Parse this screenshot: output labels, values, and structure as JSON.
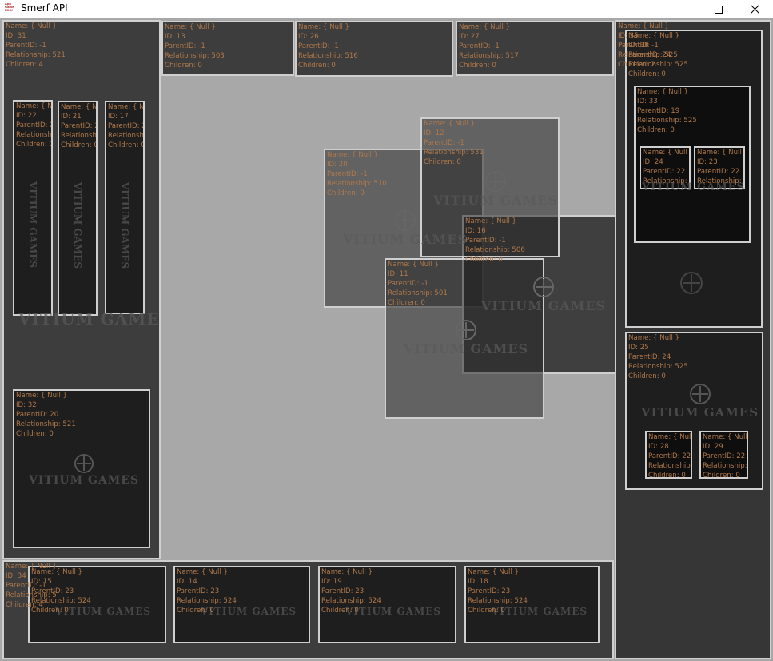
{
  "window": {
    "title": "Smerf API",
    "icon_lines": [
      "App",
      "Game",
      "Kit X"
    ],
    "minimize_icon": "minimize-icon",
    "maximize_icon": "maximize-icon",
    "close_icon": "close-icon"
  },
  "watermark": "VITIUM GAMES",
  "colors": {
    "background": "#a8a8a8",
    "label_text": "#b0784a",
    "border": "#cfcfcf"
  },
  "nodes": {
    "n31": {
      "name": "Name: { Null }",
      "id": "ID: 31",
      "parent": "ParentID: -1",
      "relationship": "Relationship: 521",
      "children": "Children: 4"
    },
    "n22": {
      "name": "Name: { Null }",
      "id": "ID: 22",
      "parent": "ParentID: 21",
      "relationship": "Relationship: 5",
      "children": "Children: 0"
    },
    "n21": {
      "name": "Name: { Null }",
      "id": "ID: 21",
      "parent": "ParentID: 2",
      "relationship": "Relationship: 5",
      "children": "Children: 0"
    },
    "n17": {
      "name": "Name: { Null }",
      "id": "ID: 17",
      "parent": "ParentID: 2",
      "relationship": "Relationship: 5",
      "children": "Children: 0"
    },
    "n32": {
      "name": "Name: { Null }",
      "id": "ID: 32",
      "parent": "ParentID: 20",
      "relationship": "Relationship: 521",
      "children": "Children: 0"
    },
    "n13": {
      "name": "Name: { Null }",
      "id": "ID: 13",
      "parent": "ParentID: -1",
      "relationship": "Relationship: 503",
      "children": "Children: 0"
    },
    "n26": {
      "name": "Name: { Null }",
      "id": "ID: 26",
      "parent": "ParentID: -1",
      "relationship": "Relationship: 516",
      "children": "Children: 0"
    },
    "n27": {
      "name": "Name: { Null }",
      "id": "ID: 27",
      "parent": "ParentID: -1",
      "relationship": "Relationship: 517",
      "children": "Children: 0"
    },
    "n20": {
      "name": "Name: { Null }",
      "id": "ID: 20",
      "parent": "ParentID: -1",
      "relationship": "Relationship: 510",
      "children": "Children: 0"
    },
    "n12": {
      "name": "Name: { Null }",
      "id": "ID: 12",
      "parent": "ParentID: -1",
      "relationship": "Relationship: 531",
      "children": "Children: 0"
    },
    "n16": {
      "name": "Name: { Null }",
      "id": "ID: 16",
      "parent": "ParentID: -1",
      "relationship": "Relationship: 506",
      "children": "Children: 0"
    },
    "n11": {
      "name": "Name: { Null }",
      "id": "ID: 11",
      "parent": "ParentID: -1",
      "relationship": "Relationship: 501",
      "children": "Children: 0"
    },
    "n35": {
      "name": "Name: { Null }",
      "id": "ID: 35",
      "parent": "ParentID: -1",
      "relationship": "Relationship: 525",
      "children": "Children: 2"
    },
    "n30": {
      "name": "Name: { Null }",
      "id": "ID: 30",
      "parent": "ParentID: 24",
      "relationship": "Relationship: 525",
      "children": "Children: 0"
    },
    "n33": {
      "name": "Name: { Null }",
      "id": "ID: 33",
      "parent": "ParentID: 19",
      "relationship": "Relationship: 525",
      "children": "Children: 0"
    },
    "n24": {
      "name": "Name: { Null }",
      "id": "ID: 24",
      "parent": "ParentID: 22",
      "relationship": "Relationship: 5",
      "children": "Children: 0"
    },
    "n23": {
      "name": "Name: { Null }",
      "id": "ID: 23",
      "parent": "ParentID: 22",
      "relationship": "Relationship: 5",
      "children": "Children: 0"
    },
    "n25": {
      "name": "Name: { Null }",
      "id": "ID: 25",
      "parent": "ParentID: 24",
      "relationship": "Relationship: 525",
      "children": "Children: 0"
    },
    "n28": {
      "name": "Name: { Null }",
      "id": "ID: 28",
      "parent": "ParentID: 22",
      "relationship": "Relationship: 5",
      "children": "Children: 0"
    },
    "n29": {
      "name": "Name: { Null }",
      "id": "ID: 29",
      "parent": "ParentID: 22",
      "relationship": "Relationship: 5",
      "children": "Children: 0"
    },
    "n34": {
      "name": "Name: { Null }",
      "id": "ID: 34",
      "parent": "ParentID: -1",
      "relationship": "Relationship: 5",
      "children": "Children: 4"
    },
    "n15": {
      "name": "Name: { Null }",
      "id": "ID: 15",
      "parent": "ParentID: 23",
      "relationship": "Relationship: 524",
      "children": "Children: 0"
    },
    "n14": {
      "name": "Name: { Null }",
      "id": "ID: 14",
      "parent": "ParentID: 23",
      "relationship": "Relationship: 524",
      "children": "Children: 0"
    },
    "n19": {
      "name": "Name: { Null }",
      "id": "ID: 19",
      "parent": "ParentID: 23",
      "relationship": "Relationship: 524",
      "children": "Children: 0"
    },
    "n18": {
      "name": "Name: { Null }",
      "id": "ID: 18",
      "parent": "ParentID: 23",
      "relationship": "Relationship: 524",
      "children": "Children: 0"
    }
  }
}
